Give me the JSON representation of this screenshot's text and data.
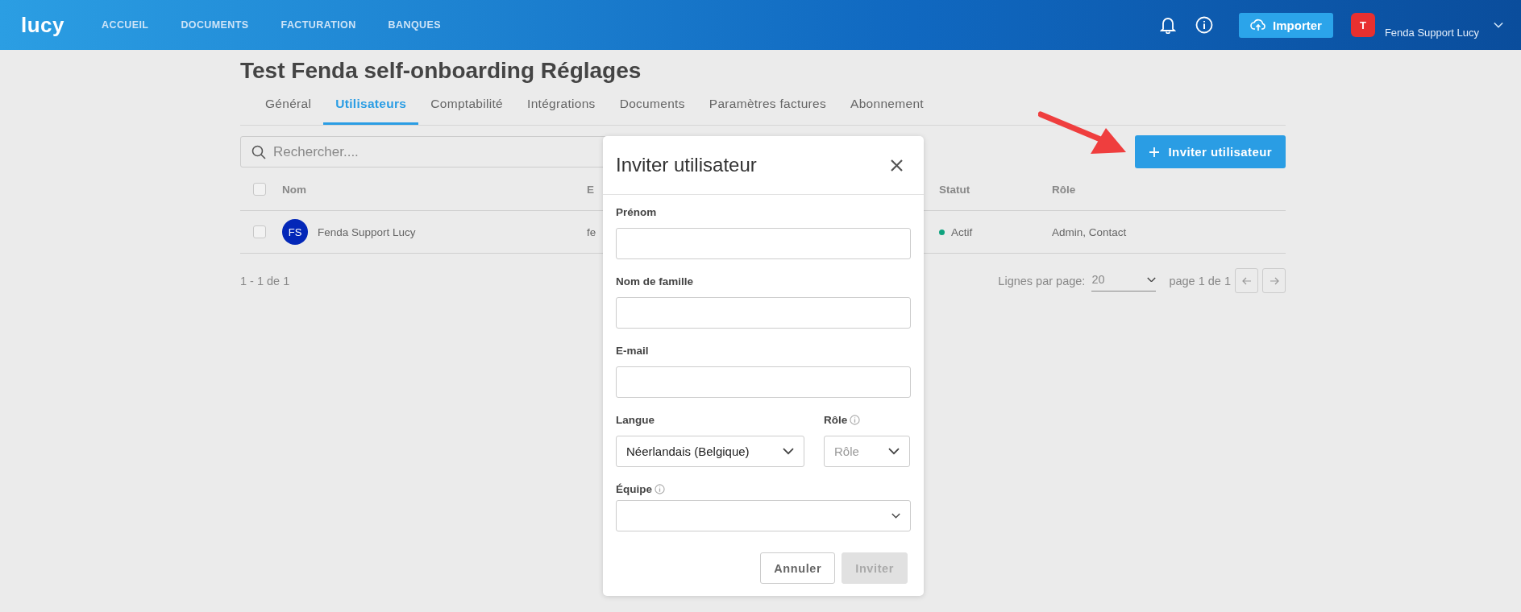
{
  "header": {
    "logo": "lucy",
    "nav": [
      "ACCUEIL",
      "DOCUMENTS",
      "FACTURATION",
      "BANQUES"
    ],
    "import_button": "Importer",
    "user": {
      "avatar": "T",
      "name": "Fenda Support Lucy"
    }
  },
  "page": {
    "title": "Test Fenda self-onboarding Réglages",
    "tabs": [
      {
        "label": "Général",
        "selected": false
      },
      {
        "label": "Utilisateurs",
        "selected": true
      },
      {
        "label": "Comptabilité",
        "selected": false
      },
      {
        "label": "Intégrations",
        "selected": false
      },
      {
        "label": "Documents",
        "selected": false
      },
      {
        "label": "Paramètres factures",
        "selected": false
      },
      {
        "label": "Abonnement",
        "selected": false
      }
    ],
    "search": {
      "placeholder": "Rechercher...."
    },
    "invite_button": "Inviter utilisateur",
    "table": {
      "all_checked": false,
      "columns": [
        "Nom",
        "E",
        "Statut",
        "Rôle"
      ],
      "rows": [
        {
          "checked": false,
          "initials": "FS",
          "name": "Fenda Support Lucy",
          "email": "fe",
          "status": "Actif",
          "color": "#0fa37f",
          "role": "Admin, Contact"
        }
      ]
    },
    "range": "1 - 1 de 1",
    "rows_per_page_label": "Lignes par page:",
    "rows_per_page": "20",
    "page_info": "page 1 de 1"
  },
  "modal": {
    "title": "Inviter utilisateur",
    "fields": [
      {
        "label": "Prénom"
      },
      {
        "label": "Nom de famille"
      },
      {
        "label": "E-mail"
      }
    ],
    "language": {
      "label": "Langue",
      "value": "Néerlandais (Belgique)"
    },
    "role": {
      "label": "Rôle",
      "placeholder": "Rôle"
    },
    "team": {
      "label": "Équipe"
    },
    "buttons": [
      {
        "label": "Annuler",
        "disabled": false
      },
      {
        "label": "Inviter",
        "disabled": true
      }
    ]
  }
}
